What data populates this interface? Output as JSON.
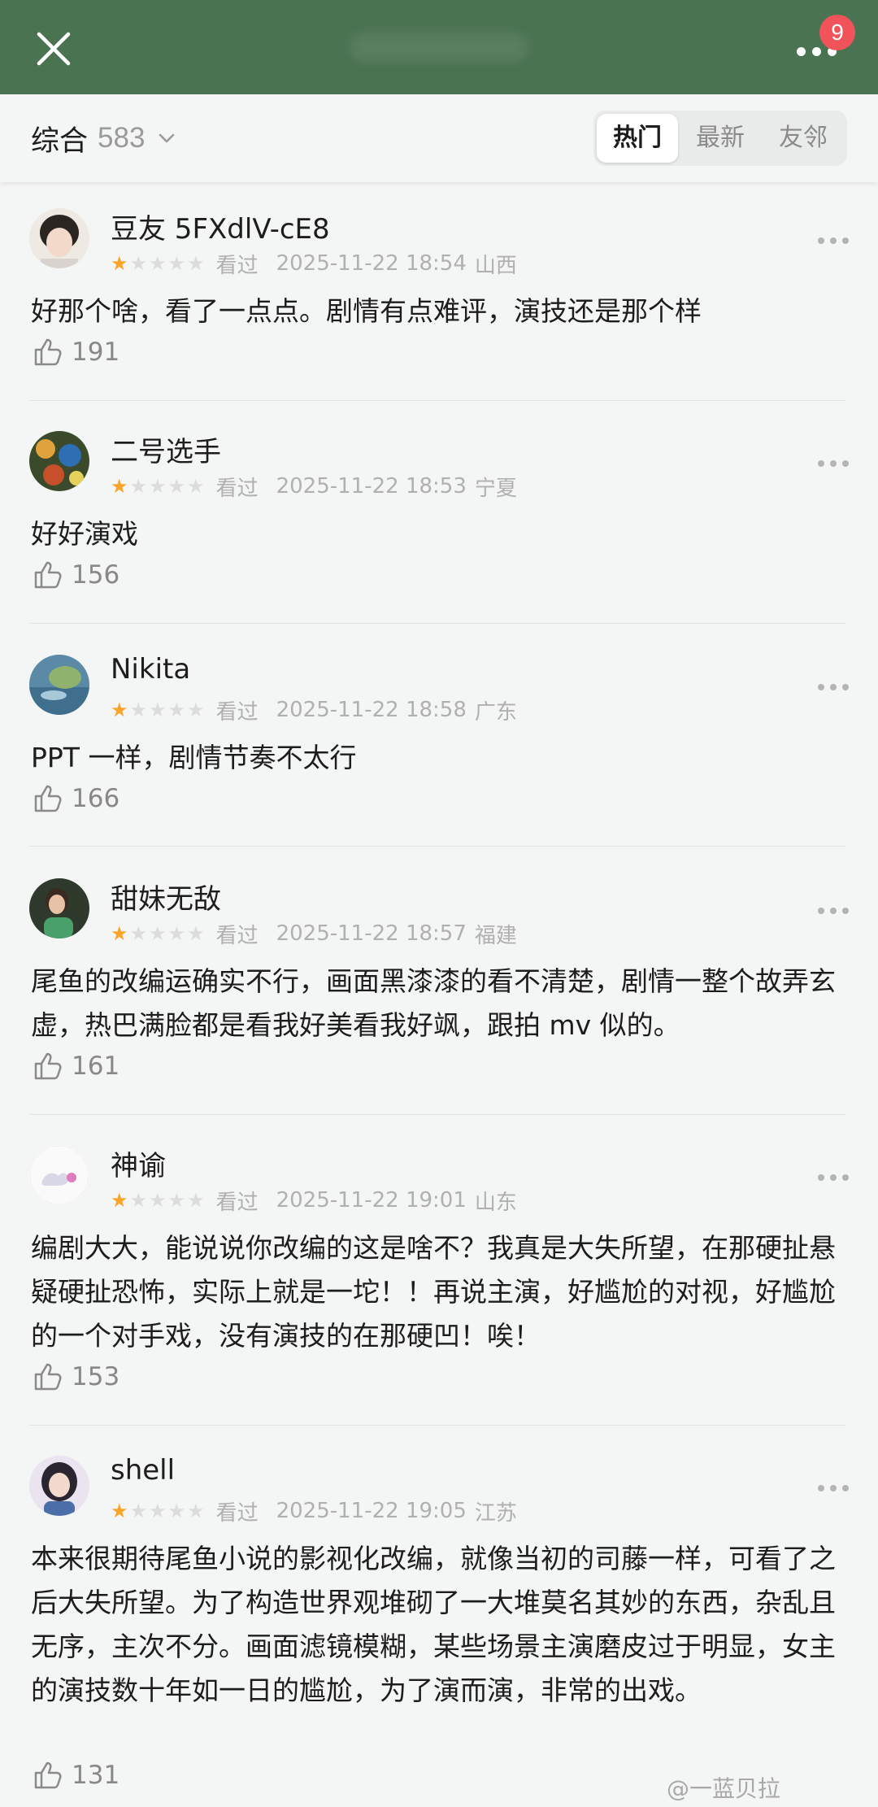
{
  "header": {
    "badge_count": "9",
    "colors": {
      "bar": "#4a7352",
      "badge": "#f0545a"
    }
  },
  "filter": {
    "label": "综合",
    "count": "583",
    "tabs": [
      "热门",
      "最新",
      "友邻"
    ],
    "active_tab": "热门"
  },
  "reviews": [
    {
      "author": "豆友 5FXdlV-cE8",
      "rating": 1,
      "status": "看过",
      "datetime": "2025-11-22 18:54",
      "location": "山西",
      "text": "好那个啥，看了一点点。剧情有点难评，演技还是那个样",
      "likes": "191"
    },
    {
      "author": "二号选手",
      "rating": 1,
      "status": "看过",
      "datetime": "2025-11-22 18:53",
      "location": "宁夏",
      "text": "好好演戏",
      "likes": "156"
    },
    {
      "author": "Nikita",
      "rating": 1,
      "status": "看过",
      "datetime": "2025-11-22 18:58",
      "location": "广东",
      "text": "PPT 一样，剧情节奏不太行",
      "likes": "166"
    },
    {
      "author": "甜妹无敌",
      "rating": 1,
      "status": "看过",
      "datetime": "2025-11-22 18:57",
      "location": "福建",
      "text": "尾鱼的改编运确实不行，画面黑漆漆的看不清楚，剧情一整个故弄玄虚，热巴满脸都是看我好美看我好飒，跟拍 mv 似的。",
      "likes": "161"
    },
    {
      "author": "神谕",
      "rating": 1,
      "status": "看过",
      "datetime": "2025-11-22 19:01",
      "location": "山东",
      "text": "编剧大大，能说说你改编的这是啥不？我真是大失所望，在那硬扯悬疑硬扯恐怖，实际上就是一坨！！再说主演，好尴尬的对视，好尴尬的一个对手戏，没有演技的在那硬凹！唉！",
      "likes": "153"
    },
    {
      "author": "shell",
      "rating": 1,
      "status": "看过",
      "datetime": "2025-11-22 19:05",
      "location": "江苏",
      "text": "本来很期待尾鱼小说的影视化改编，就像当初的司藤一样，可看了之后大失所望。为了构造世界观堆砌了一大堆莫名其妙的东西，杂乱且无序，主次不分。画面滤镜模糊，某些场景主演磨皮过于明显，女主的演技数十年如一日的尴尬，为了演而演，非常的出戏。",
      "likes": "131"
    }
  ],
  "watermark": "@一蓝贝拉",
  "star_colors": {
    "on": "#f7a428",
    "off": "#dcdcdc"
  }
}
